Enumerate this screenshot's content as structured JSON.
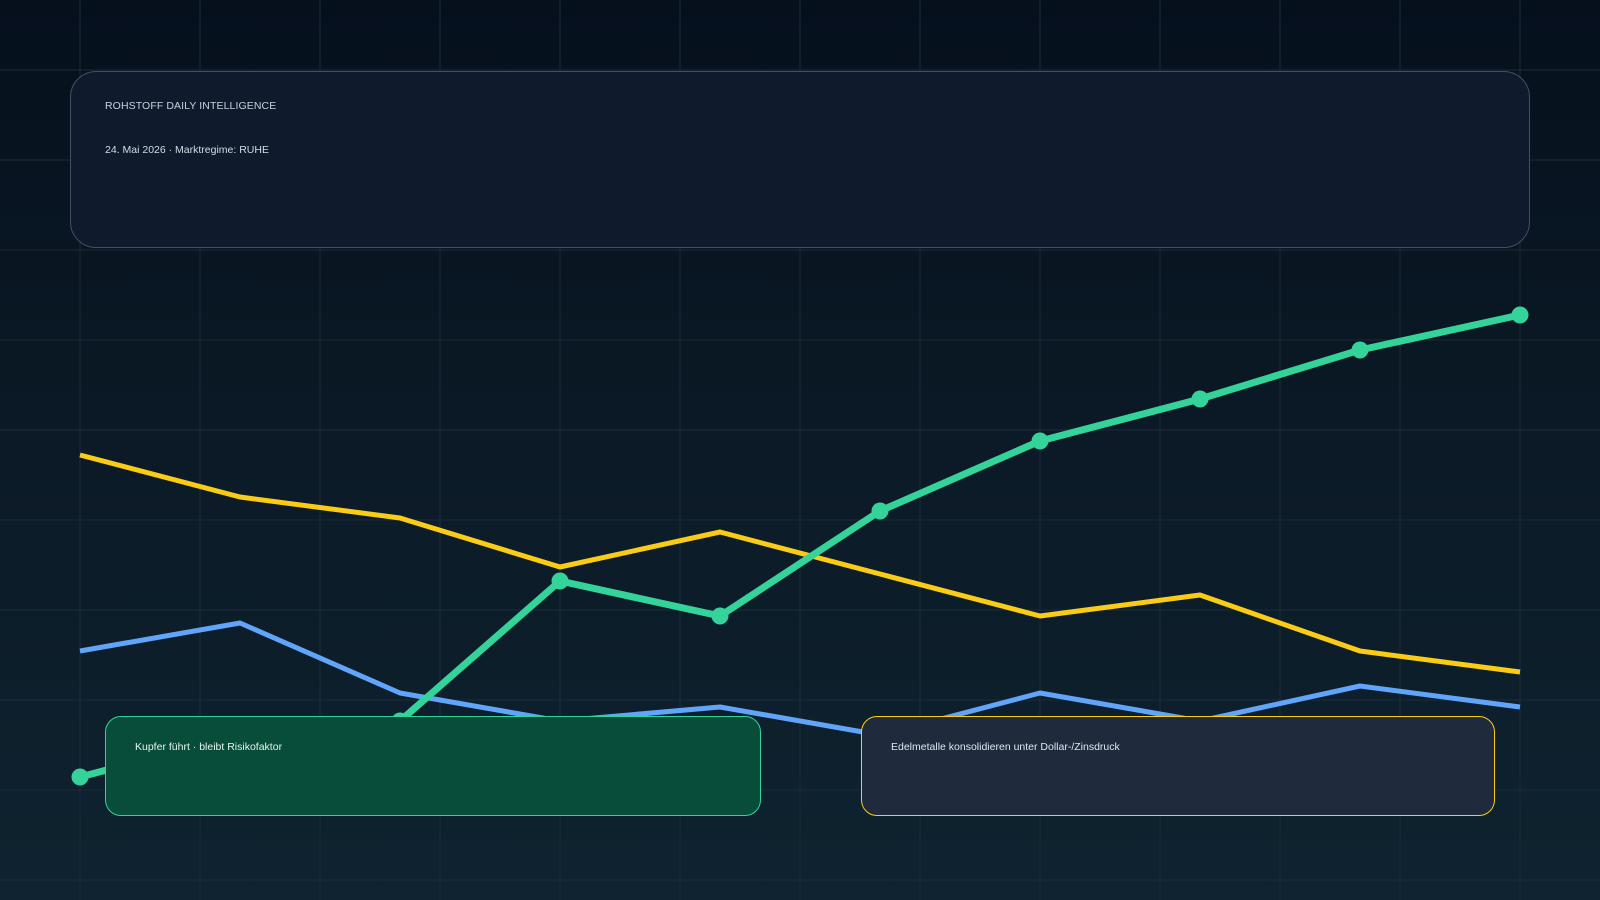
{
  "header": {
    "brand": "ROHSTOFF DAILY INTELLIGENCE",
    "subtitle": "24. Mai 2026 · Marktregime: RUHE"
  },
  "notes": [
    {
      "text": "Kupfer führt · bleibt Risikofaktor",
      "accent": "#34d399"
    },
    {
      "text": "Edelmetalle konsolidieren unter Dollar-/Zinsdruck",
      "accent": "#facc15"
    }
  ],
  "colors": {
    "background_top": "#06101d",
    "background_bottom": "#0f2330",
    "card": "#101a2d",
    "grid": "#1b2b3a"
  },
  "chart_data": {
    "type": "line",
    "grid": true,
    "legend": "none",
    "x": [
      1,
      2,
      3,
      4,
      5,
      6,
      7,
      8,
      9,
      10
    ],
    "ylim": [
      0,
      100
    ],
    "series": [
      {
        "color": "#34d399",
        "markers": true,
        "values": [
          14,
          20,
          22,
          42,
          37,
          52,
          62,
          68,
          75,
          80
        ]
      },
      {
        "color": "#facc15",
        "markers": false,
        "values": [
          60,
          54,
          51,
          44,
          49,
          43,
          37,
          40,
          32,
          29
        ]
      },
      {
        "color": "#60a5fa",
        "markers": false,
        "values": [
          32,
          36,
          26,
          22,
          24,
          20,
          26,
          22,
          27,
          24
        ]
      }
    ]
  }
}
